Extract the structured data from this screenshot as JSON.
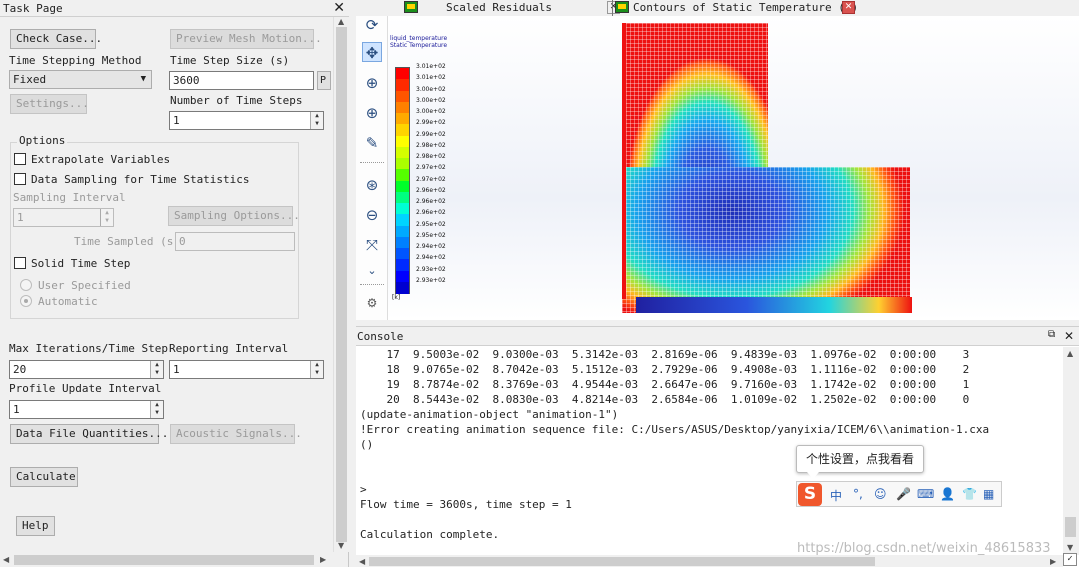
{
  "task_page": {
    "title": "Task Page",
    "close": "✕",
    "check_case": "Check Case...",
    "preview_mesh_motion": "Preview Mesh Motion...",
    "time_stepping_method_label": "Time Stepping Method",
    "time_stepping_method_value": "Fixed",
    "time_step_size_label": "Time Step Size (s)",
    "time_step_size_value": "3600",
    "p_button": "P",
    "settings": "Settings...",
    "number_of_time_steps_label": "Number of Time Steps",
    "number_of_time_steps_value": "1",
    "options_title": "Options",
    "extrapolate_variables": "Extrapolate Variables",
    "data_sampling": "Data Sampling for Time Statistics",
    "sampling_interval_label": "Sampling Interval",
    "sampling_interval_value": "1",
    "sampling_options": "Sampling Options...",
    "time_sampled_label": "Time Sampled (s)",
    "time_sampled_value": "0",
    "solid_time_step": "Solid Time Step",
    "user_specified": "User Specified",
    "automatic": "Automatic",
    "max_iterations_label": "Max Iterations/Time Step",
    "max_iterations_value": "20",
    "reporting_interval_label": "Reporting Interval",
    "reporting_interval_value": "1",
    "profile_update_interval_label": "Profile Update Interval",
    "profile_update_interval_value": "1",
    "data_file_quantities": "Data File Quantities...",
    "acoustic_signals": "Acoustic Signals...",
    "calculate": "Calculate",
    "help": "Help"
  },
  "graphics": {
    "tabs": [
      {
        "label": "Scaled Residuals",
        "active": false
      },
      {
        "label": "Contours of Static Temperature (k)",
        "active": true
      }
    ],
    "tools": [
      "rotate-icon",
      "pan-icon",
      "zoom-in-icon",
      "zoom-to-fit-icon",
      "probe-icon",
      "zoom-box-icon",
      "zoom-out-icon",
      "axes-icon",
      "more-icon",
      "view-icon"
    ],
    "legend": {
      "title_line1": "liquid_temperature",
      "title_line2": "Static Temperature",
      "labels": [
        "3.01e+02",
        "3.01e+02",
        "3.00e+02",
        "3.00e+02",
        "3.00e+02",
        "2.99e+02",
        "2.99e+02",
        "2.98e+02",
        "2.98e+02",
        "2.97e+02",
        "2.97e+02",
        "2.96e+02",
        "2.96e+02",
        "2.96e+02",
        "2.95e+02",
        "2.95e+02",
        "2.94e+02",
        "2.94e+02",
        "2.93e+02",
        "2.93e+02"
      ],
      "unit": "[k]"
    }
  },
  "console": {
    "title": "Console",
    "lines": [
      "    17  9.5003e-02  9.0300e-03  5.3142e-03  2.8169e-06  9.4839e-03  1.0976e-02  0:00:00    3",
      "    18  9.0765e-02  8.7042e-03  5.1512e-03  2.7929e-06  9.4908e-03  1.1116e-02  0:00:00    2",
      "    19  8.7874e-02  8.3769e-03  4.9544e-03  2.6647e-06  9.7160e-03  1.1742e-02  0:00:00    1",
      "    20  8.5443e-02  8.0830e-03  4.8214e-03  2.6584e-06  1.0109e-02  1.2502e-02  0:00:00    0",
      "(update-animation-object \"animation-1\")",
      "!Error creating animation sequence file: C:/Users/ASUS/Desktop/yanyixia/ICEM/6\\\\animation-1.cxa",
      "()",
      "",
      "",
      ">",
      "Flow time = 3600s, time step = 1",
      "",
      "Calculation complete."
    ]
  },
  "ime": {
    "tip": "个性设置，点我看看",
    "logo": "S",
    "icons": [
      "中",
      "°,",
      "☺",
      "🎤",
      "⌨",
      "👤",
      "👕",
      "▦"
    ]
  },
  "watermark": "https://blog.csdn.net/weixin_48615833"
}
